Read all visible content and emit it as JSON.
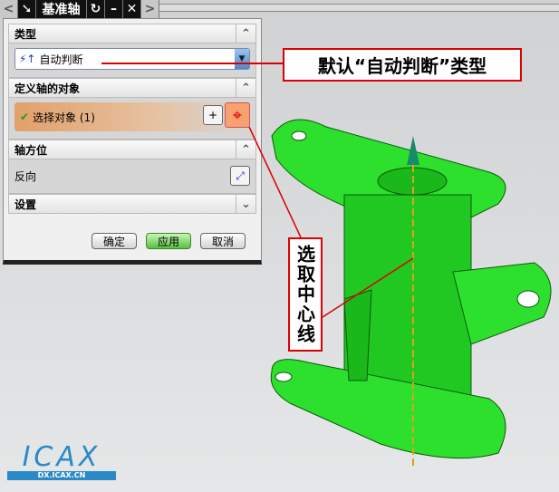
{
  "titlebar": {
    "title": "基准轴"
  },
  "sections": {
    "type": {
      "label": "类型",
      "value": "自动判断"
    },
    "objects": {
      "label": "定义轴的对象",
      "select_label": "选择对象 (1)"
    },
    "orientation": {
      "label": "轴方位",
      "reverse_label": "反向"
    },
    "settings": {
      "label": "设置"
    }
  },
  "buttons": {
    "ok": "确定",
    "apply": "应用",
    "cancel": "取消"
  },
  "callouts": {
    "default_type": "默认“自动判断”类型",
    "select_center": "选取中心线"
  },
  "logo": {
    "text": "ICAX",
    "url_text": "DX.ICAX.CN"
  },
  "colors": {
    "model": "#2ee02e",
    "accent_red": "#dd0000"
  }
}
